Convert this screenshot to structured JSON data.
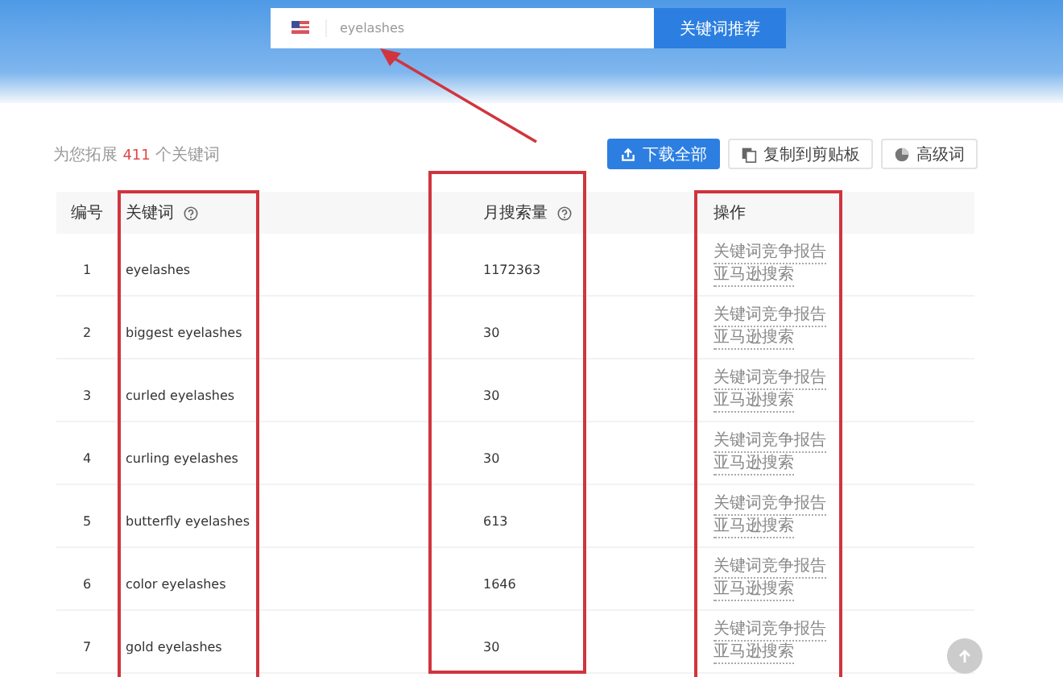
{
  "search": {
    "value": "eyelashes",
    "button": "关键词推荐"
  },
  "summary": {
    "prefix": "为您拓展",
    "count": "411",
    "suffix": "个关键词"
  },
  "actions": [
    {
      "label": "下载全部",
      "kind": "download"
    },
    {
      "label": "复制到剪贴板",
      "kind": "copy"
    },
    {
      "label": "高级词",
      "kind": "advanced"
    }
  ],
  "table": {
    "columns": [
      {
        "label": "编号",
        "help": false
      },
      {
        "label": "关键词",
        "help": true
      },
      {
        "label": "月搜索量",
        "help": true
      },
      {
        "label": "操作",
        "help": false
      }
    ],
    "rows": [
      {
        "index": "1",
        "keyword": "eyelashes",
        "volume": "1172363",
        "links": [
          "关键词竞争报告",
          "亚马逊搜索"
        ]
      },
      {
        "index": "2",
        "keyword": "biggest eyelashes",
        "volume": "30",
        "links": [
          "关键词竞争报告",
          "亚马逊搜索"
        ]
      },
      {
        "index": "3",
        "keyword": "curled eyelashes",
        "volume": "30",
        "links": [
          "关键词竞争报告",
          "亚马逊搜索"
        ]
      },
      {
        "index": "4",
        "keyword": "curling eyelashes",
        "volume": "30",
        "links": [
          "关键词竞争报告",
          "亚马逊搜索"
        ]
      },
      {
        "index": "5",
        "keyword": "butterfly eyelashes",
        "volume": "613",
        "links": [
          "关键词竞争报告",
          "亚马逊搜索"
        ]
      },
      {
        "index": "6",
        "keyword": "color eyelashes",
        "volume": "1646",
        "links": [
          "关键词竞争报告",
          "亚马逊搜索"
        ]
      },
      {
        "index": "7",
        "keyword": "gold eyelashes",
        "volume": "30",
        "links": [
          "关键词竞争报告",
          "亚马逊搜索"
        ]
      }
    ]
  }
}
